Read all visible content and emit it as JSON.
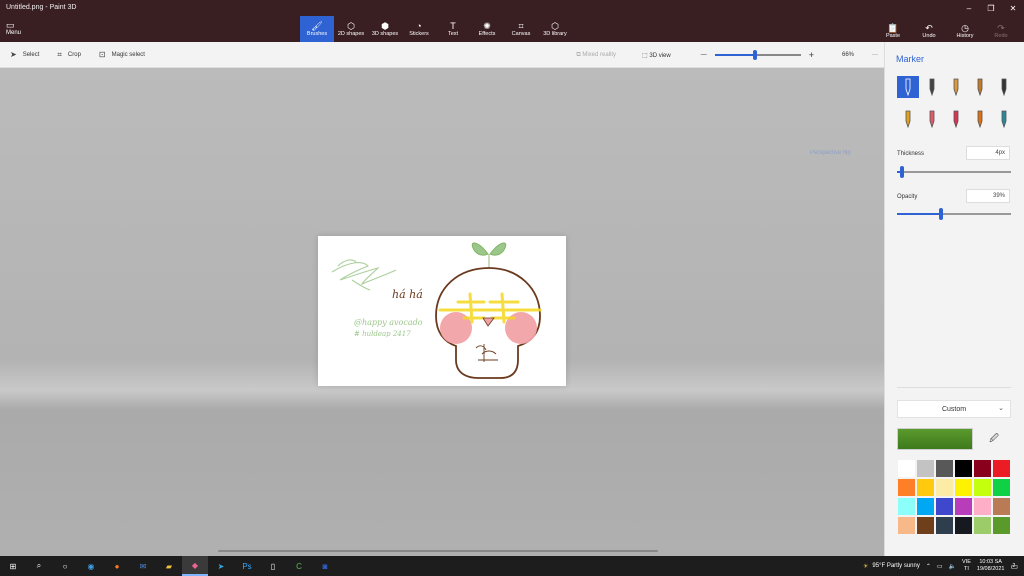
{
  "window": {
    "title": "Untitled.png - Paint 3D",
    "controls": [
      "–",
      "❐",
      "✕"
    ]
  },
  "ribbon": {
    "menu": {
      "icon": "menu-icon",
      "label": "Menu"
    },
    "tabs": [
      {
        "id": "brushes",
        "label": "Brushes",
        "icon": "brush-icon",
        "glyph": "🖌",
        "active": true
      },
      {
        "id": "2d-shapes",
        "label": "2D shapes",
        "icon": "shapes-2d-icon",
        "glyph": "⬡"
      },
      {
        "id": "3d-shapes",
        "label": "3D shapes",
        "icon": "cube-icon",
        "glyph": "⬢"
      },
      {
        "id": "stickers",
        "label": "Stickers",
        "icon": "sticker-icon",
        "glyph": "◔"
      },
      {
        "id": "text",
        "label": "Text",
        "icon": "text-icon",
        "glyph": "T"
      },
      {
        "id": "effects",
        "label": "Effects",
        "icon": "effects-icon",
        "glyph": "✺"
      },
      {
        "id": "canvas",
        "label": "Canvas",
        "icon": "canvas-icon",
        "glyph": "⌗"
      },
      {
        "id": "3d-library",
        "label": "3D library",
        "icon": "library-icon",
        "glyph": "⬡"
      }
    ],
    "right": [
      {
        "id": "paste",
        "label": "Paste",
        "icon": "paste-icon",
        "glyph": "📋",
        "enabled": true
      },
      {
        "id": "undo",
        "label": "Undo",
        "icon": "undo-icon",
        "glyph": "↶",
        "enabled": true
      },
      {
        "id": "history",
        "label": "History",
        "icon": "history-icon",
        "glyph": "◷",
        "enabled": true
      },
      {
        "id": "redo",
        "label": "Redo",
        "icon": "redo-icon",
        "glyph": "↷",
        "enabled": false
      }
    ]
  },
  "subbar": {
    "select": "Select",
    "crop": "Crop",
    "magic_select": "Magic select",
    "mixed_reality": "Mixed reality",
    "view_3d": "3D view",
    "zoom_minus": "—",
    "zoom_plus": "+",
    "zoom": "66%",
    "more": "···"
  },
  "canvas_hint": "Perspective flip",
  "panel": {
    "title": "Marker",
    "brushes": [
      {
        "name": "marker-brush-icon",
        "color": "#ffffff",
        "active": true
      },
      {
        "name": "calligraphy-pen-icon",
        "color": "#444444"
      },
      {
        "name": "oil-brush-icon",
        "color": "#d89a3c"
      },
      {
        "name": "watercolor-icon",
        "color": "#c27a2a"
      },
      {
        "name": "pixel-pen-icon",
        "color": "#333333"
      },
      {
        "name": "pencil-icon",
        "color": "#e0a020"
      },
      {
        "name": "eraser-icon",
        "color": "#e05a6a"
      },
      {
        "name": "crayon-icon",
        "color": "#e03050"
      },
      {
        "name": "spray-can-icon",
        "color": "#e07010"
      },
      {
        "name": "fill-bucket-icon",
        "color": "#2a8a9a"
      }
    ],
    "thickness_label": "Thickness",
    "thickness_value": "4px",
    "thickness_level": 0.04,
    "opacity_label": "Opacity",
    "opacity_value": "39%",
    "opacity_level": 0.39,
    "color_mode": "Custom",
    "current_color": "#5b9a2e",
    "palette": [
      "#ffffff",
      "#c3c3c3",
      "#585858",
      "#000000",
      "#88001b",
      "#ec1c24",
      "#ff7f27",
      "#ffc90e",
      "#fdeca6",
      "#fff200",
      "#c4ff0e",
      "#0ed145",
      "#8cfffb",
      "#00a8f3",
      "#3f48cc",
      "#b83dba",
      "#ffaec8",
      "#b97a56",
      "#f7b98a",
      "#6f3f1c",
      "#2e3e4c",
      "#161a20",
      "#9ccb6a",
      "#5a9a2a"
    ]
  },
  "artwork": {
    "hand_text": "há há",
    "handle": "@happy avocado",
    "hashtag": "# huldeap 2417"
  },
  "taskbar": {
    "weather": "95°F  Partly sunny",
    "lang_line1": "VIE",
    "lang_line2": "TI",
    "time": "10:03 SA",
    "date": "19/08/2021",
    "notif_count": "2"
  }
}
